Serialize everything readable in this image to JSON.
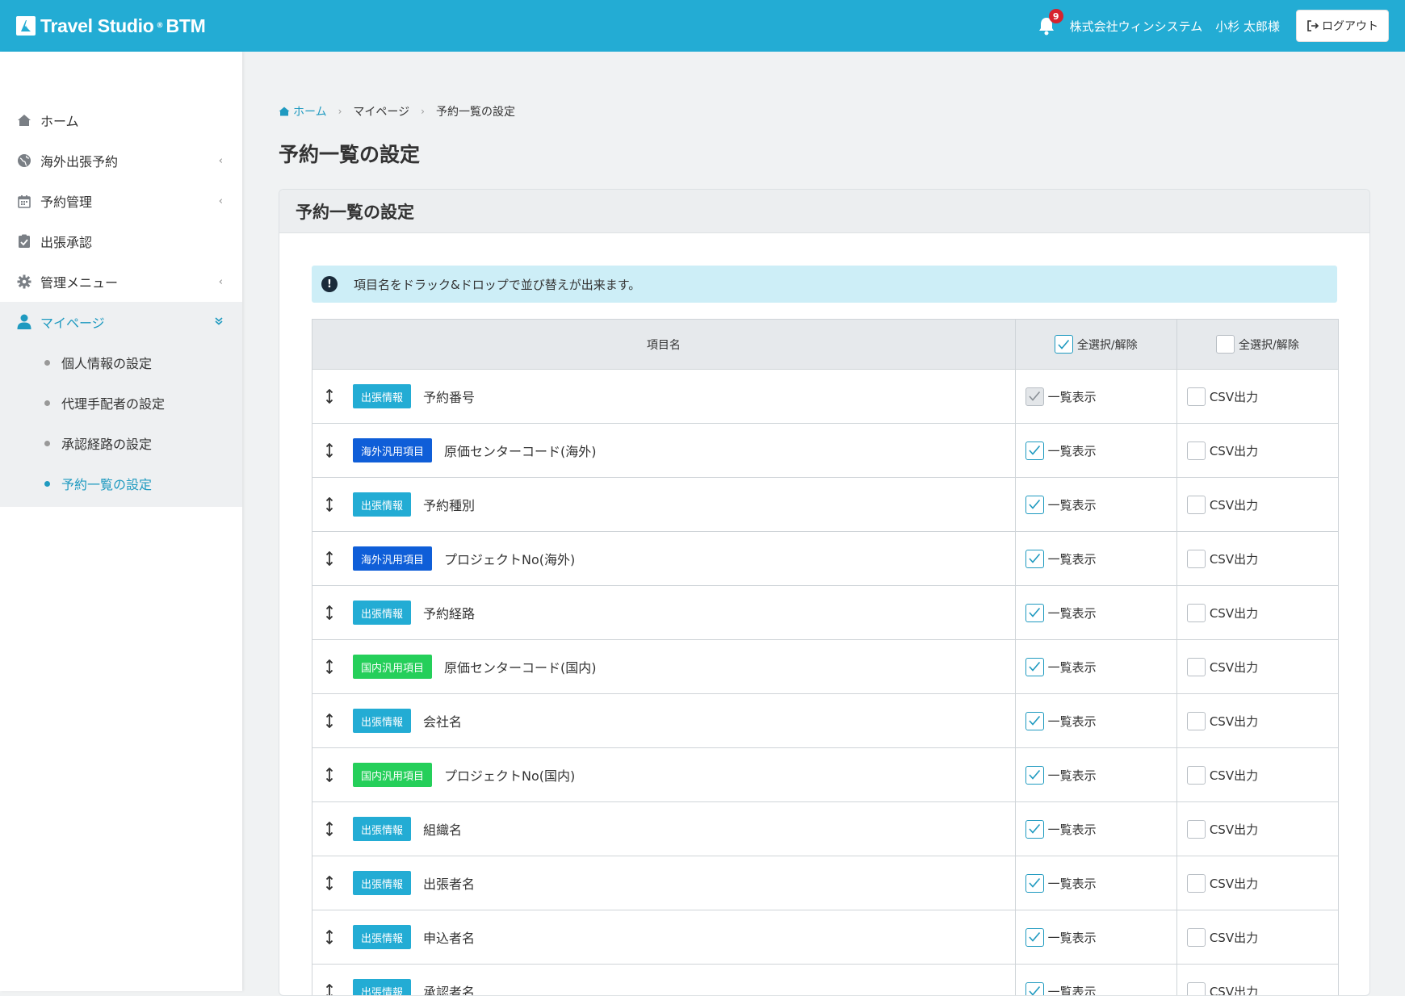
{
  "header": {
    "brand": "Travel Studio",
    "brand_mark": "®",
    "brand_suffix": "BTM",
    "notification_count": "9",
    "company": "株式会社ウィンシステム",
    "user": "小杉 太郎様",
    "logout_label": "ログアウト"
  },
  "sidebar": {
    "items": [
      {
        "label": "ホーム",
        "icon": "home-icon",
        "chevron": ""
      },
      {
        "label": "海外出張予約",
        "icon": "globe-icon",
        "chevron": "‹"
      },
      {
        "label": "予約管理",
        "icon": "calendar-icon",
        "chevron": "‹"
      },
      {
        "label": "出張承認",
        "icon": "clipboard-check-icon",
        "chevron": ""
      },
      {
        "label": "管理メニュー",
        "icon": "gear-icon",
        "chevron": "‹"
      },
      {
        "label": "マイページ",
        "icon": "user-icon",
        "chevron": "»"
      }
    ],
    "subitems": [
      {
        "label": "個人情報の設定"
      },
      {
        "label": "代理手配者の設定"
      },
      {
        "label": "承認経路の設定"
      },
      {
        "label": "予約一覧の設定"
      }
    ]
  },
  "breadcrumb": {
    "home": "ホーム",
    "mypage": "マイページ",
    "current": "予約一覧の設定"
  },
  "page": {
    "title": "予約一覧の設定",
    "card_title": "予約一覧の設定",
    "alert": "項目名をドラック&ドロップで並び替えが出来ます。"
  },
  "table": {
    "col_name": "項目名",
    "col_list": "全選択/解除",
    "col_csv": "全選択/解除",
    "list_label": "一覧表示",
    "csv_label": "CSV出力",
    "rows": [
      {
        "tag": "出張情報",
        "tag_type": "trip",
        "name": "予約番号"
      },
      {
        "tag": "海外汎用項目",
        "tag_type": "overseas",
        "name": "原価センターコード(海外)"
      },
      {
        "tag": "出張情報",
        "tag_type": "trip",
        "name": "予約種別"
      },
      {
        "tag": "海外汎用項目",
        "tag_type": "overseas",
        "name": "プロジェクトNo(海外)"
      },
      {
        "tag": "出張情報",
        "tag_type": "trip",
        "name": "予約経路"
      },
      {
        "tag": "国内汎用項目",
        "tag_type": "domestic",
        "name": "原価センターコード(国内)"
      },
      {
        "tag": "出張情報",
        "tag_type": "trip",
        "name": "会社名"
      },
      {
        "tag": "国内汎用項目",
        "tag_type": "domestic",
        "name": "プロジェクトNo(国内)"
      },
      {
        "tag": "出張情報",
        "tag_type": "trip",
        "name": "組織名"
      },
      {
        "tag": "出張情報",
        "tag_type": "trip",
        "name": "出張者名"
      },
      {
        "tag": "出張情報",
        "tag_type": "trip",
        "name": "申込者名"
      },
      {
        "tag": "出張情報",
        "tag_type": "trip",
        "name": "承認者名"
      }
    ]
  }
}
